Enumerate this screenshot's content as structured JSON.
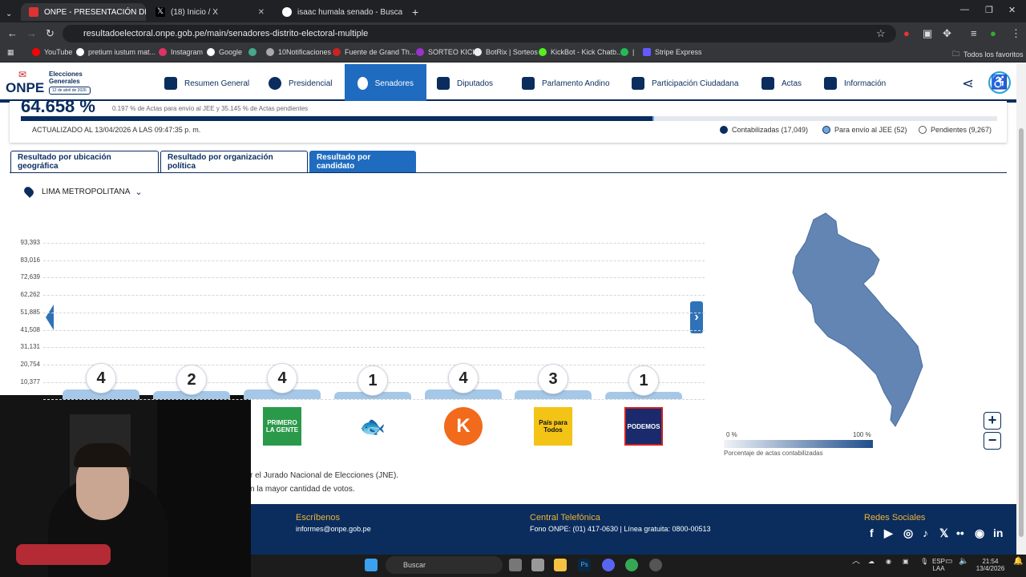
{
  "browser": {
    "tabs": [
      {
        "title": "ONPE - PRESENTACIÓN DE RES",
        "active": true
      },
      {
        "title": "(18) Inicio / X",
        "active": false
      },
      {
        "title": "isaac humala senado - Buscar c",
        "active": false
      }
    ],
    "url": "resultadoelectoral.onpe.gob.pe/main/senadores-distrito-electoral-multiple",
    "bookmarks": [
      "YouTube",
      "pretium iustum mat...",
      "Instagram",
      "Google",
      "10Notificaciones",
      "Fuente de Grand Th...",
      "SORTEO KICK",
      "BotRix | Sorteos",
      "KickBot - Kick Chatb...",
      "|",
      "Stripe Express"
    ],
    "all_bookmarks": "Todos los favoritos"
  },
  "site": {
    "logo": "ONPE",
    "logo_sub": "Elecciones Generales",
    "logo_date": "12 de abril de 2026",
    "menu": [
      "Resumen General",
      "Presidencial",
      "Senadores",
      "Diputados",
      "Parlamento Andino",
      "Participación Ciudadana",
      "Actas",
      "Información"
    ],
    "active_menu": "Senadores"
  },
  "progress": {
    "percent_label": "64.658 %",
    "note": "0.197 % de Actas para envío al JEE y 35.145 % de Actas pendientes",
    "contabilizadas_fraction": 0.6466,
    "jee_fraction": 0.002,
    "updated": "ACTUALIZADO AL 13/04/2026 A LAS 09:47:35 p. m.",
    "legend": [
      {
        "label": "Contabilizadas (17,049)",
        "color": "#0a2d5e"
      },
      {
        "label": "Para envío al JEE (52)",
        "color": "#6fa8dc"
      },
      {
        "label": "Pendientes (9,267)",
        "color": "#ffffff"
      }
    ]
  },
  "result_tabs": [
    "Resultado por ubicación geográfica",
    "Resultado por organización política",
    "Resultado por candidato"
  ],
  "active_result_tab": "Resultado por candidato",
  "location": "LIMA METROPOLITANA",
  "chart_data": {
    "type": "bar",
    "y_ticks": [
      "93,393",
      "83,016",
      "72,639",
      "62,262",
      "51,885",
      "41,508",
      "31,131",
      "20,754",
      "10,377"
    ],
    "seats": [
      4,
      2,
      4,
      1,
      4,
      3,
      1
    ],
    "parties": [
      "",
      "",
      "PRIMERO LA GENTE",
      "",
      "",
      "País para Todos",
      "PODEMOS"
    ]
  },
  "notes": [
    "r el Jurado Nacional de Elecciones (JNE).",
    "n la mayor cantidad de votos."
  ],
  "map_scale": {
    "min": "0 %",
    "max": "100 %",
    "caption": "Porcentaje de actas contabilizadas"
  },
  "footer": {
    "escribenos": "Escríbenos",
    "email": "informes@onpe.gob.pe",
    "central": "Central Telefónica",
    "fono": "Fono ONPE: (01) 417-0630 | Línea gratuita: 0800-00513",
    "redes": "Redes Sociales"
  },
  "taskbar": {
    "search": "Buscar",
    "lang": "ESP",
    "lang2": "LAA",
    "time": "21:54",
    "date": "13/4/2026"
  }
}
